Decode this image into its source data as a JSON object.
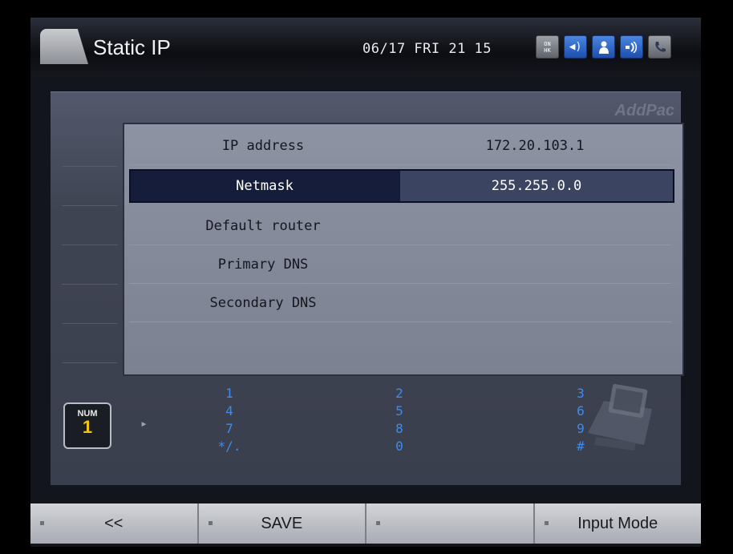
{
  "header": {
    "title": "Static IP",
    "datetime": "06/17 FRI 21 15",
    "status_icons": [
      "on-hook-icon",
      "speaker-icon",
      "user-icon",
      "network-icon",
      "phone-icon"
    ],
    "icon_glyphs": [
      "ON HK",
      "◀)",
      "👤",
      "▪◖",
      "✆"
    ]
  },
  "brand": "AddPac",
  "settings": {
    "rows": [
      {
        "label": "IP address",
        "value": "172.20.103.1"
      },
      {
        "label": "Netmask",
        "value": "255.255.0.0"
      },
      {
        "label": "Default router",
        "value": ""
      },
      {
        "label": "Primary DNS",
        "value": ""
      },
      {
        "label": "Secondary DNS",
        "value": ""
      },
      {
        "label": "",
        "value": ""
      }
    ],
    "selected_index": 1
  },
  "input_mode": {
    "badge_label": "NUM",
    "badge_number": "1",
    "keypad": {
      "col1": [
        "1",
        "4",
        "7",
        "*/."
      ],
      "col2": [
        "2",
        "5",
        "8",
        "0"
      ],
      "col3": [
        "3",
        "6",
        "9",
        "#"
      ]
    }
  },
  "softkeys": [
    "<<",
    "SAVE",
    "",
    "Input Mode"
  ],
  "colors": {
    "keypad_digit": "#3d8bf0",
    "selected_row": "#161d3b",
    "badge_number": "#f1c40f"
  }
}
